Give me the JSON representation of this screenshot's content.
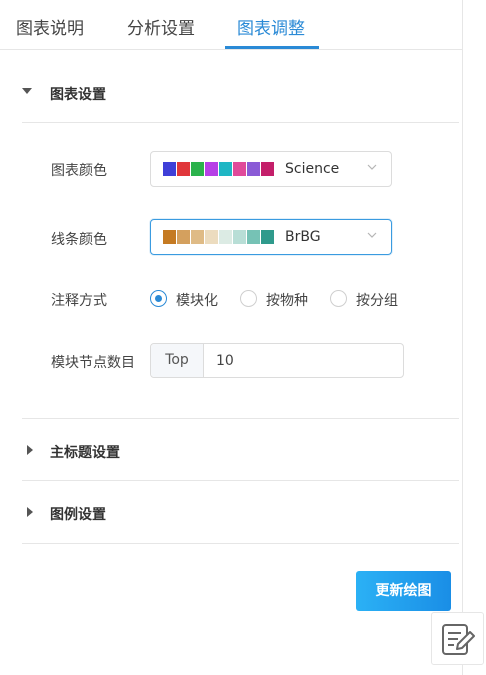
{
  "tabs": [
    {
      "label": "图表说明"
    },
    {
      "label": "分析设置"
    },
    {
      "label": "图表调整"
    }
  ],
  "active_tab": "图表调整",
  "accent_color": "#2a8ad6",
  "chart_settings": {
    "title": "图表设置",
    "chart_color": {
      "label": "图表颜色",
      "value": "Science",
      "swatches": [
        "#3f3fd8",
        "#e0373b",
        "#2bb24c",
        "#b640e6",
        "#1fb6c4",
        "#e04a9a",
        "#8a5bd6",
        "#c41f6a"
      ]
    },
    "line_color": {
      "label": "线条颜色",
      "value": "BrBG",
      "swatches": [
        "#c57a22",
        "#d4a05e",
        "#dfbb86",
        "#ecdcbf",
        "#dcebe4",
        "#b8ded6",
        "#76c2b5",
        "#2f9a8c"
      ]
    },
    "annotation": {
      "label": "注释方式",
      "options": [
        "模块化",
        "按物种",
        "按分组"
      ],
      "selected": "模块化"
    },
    "module_nodes": {
      "label": "模块节点数目",
      "prefix": "Top",
      "value": "10"
    }
  },
  "collapsed_sections": [
    {
      "title": "主标题设置"
    },
    {
      "title": "图例设置"
    }
  ],
  "update_button": {
    "label": "更新绘图"
  },
  "icons": {
    "expanded": "caret-down-icon",
    "collapsed": "caret-right-icon",
    "dropdown": "chevron-down-icon",
    "float": "edit-note-icon"
  }
}
